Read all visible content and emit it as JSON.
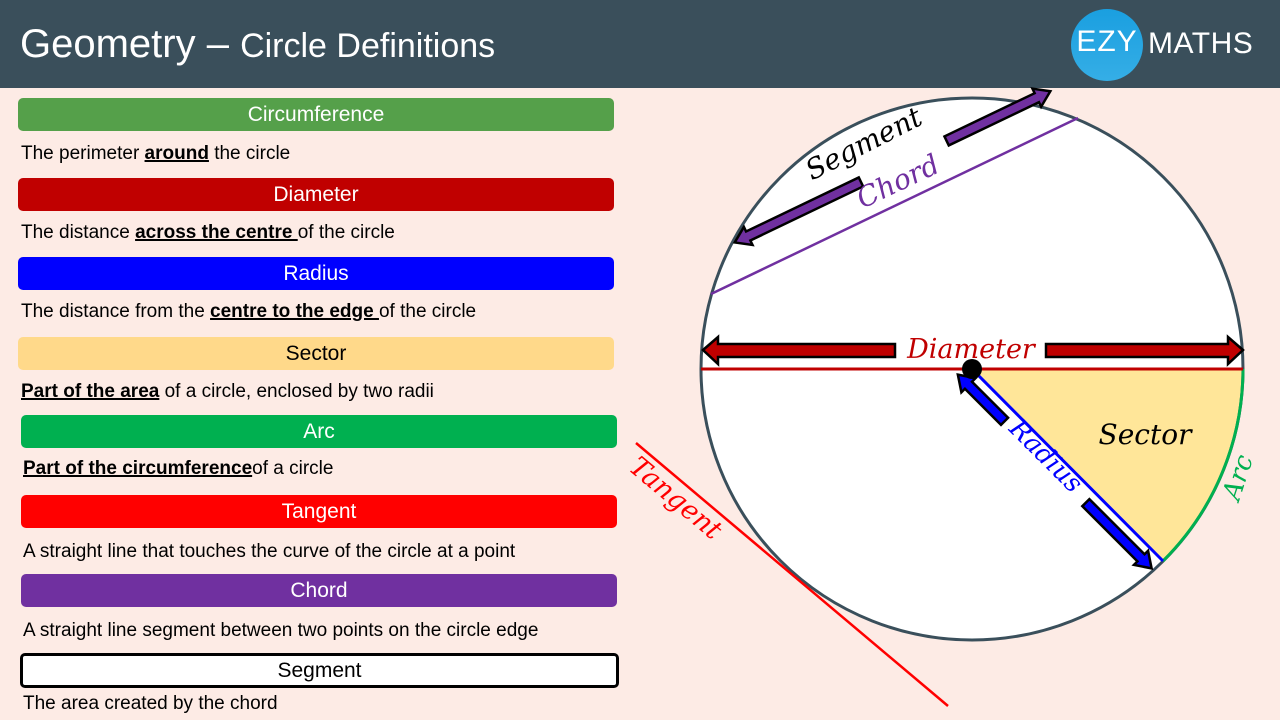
{
  "header": {
    "title_main": "Geometry – ",
    "title_sub": "Circle Definitions",
    "logo": {
      "badge": "EZY",
      "word": "MATHS",
      "badge_color": "#1ea3e2"
    }
  },
  "definitions": [
    {
      "term": "Circumference",
      "color": "#55a04a",
      "text_color": "#ffffff",
      "pre": "The perimeter ",
      "bold": "around",
      "post": " the circle"
    },
    {
      "term": "Diameter",
      "color": "#c00000",
      "text_color": "#ffffff",
      "pre": "The distance ",
      "bold": "across the centre ",
      "post": "of the circle"
    },
    {
      "term": "Radius",
      "color": "#0000ff",
      "text_color": "#ffffff",
      "pre": "The distance from the ",
      "bold": "centre to the edge ",
      "post": "of the circle"
    },
    {
      "term": "Sector",
      "color": "#ffd98a",
      "text_color": "#000000",
      "pre": "",
      "bold": "Part of the area",
      "post": " of a circle, enclosed by two radii"
    },
    {
      "term": "Arc",
      "color": "#00b050",
      "text_color": "#ffffff",
      "pre": "",
      "bold": "Part of the circumference",
      "post": "of a circle"
    },
    {
      "term": "Tangent",
      "color": "#ff0000",
      "text_color": "#ffffff",
      "pre": "A straight line that touches the curve of the circle at a point",
      "bold": "",
      "post": ""
    },
    {
      "term": "Chord",
      "color": "#7030a0",
      "text_color": "#ffffff",
      "pre": "A straight line segment between two points on the circle edge",
      "bold": "",
      "post": ""
    },
    {
      "term": "Segment",
      "color": "#ffffff",
      "text_color": "#000000",
      "pre": "The area created by the chord",
      "bold": "",
      "post": ""
    }
  ],
  "diagram": {
    "labels": {
      "segment": "Segment",
      "chord": "Chord",
      "diameter": "Diameter",
      "radius": "Radius",
      "sector": "Sector",
      "arc": "Arc",
      "tangent": "Tangent"
    },
    "colors": {
      "circle": "#3a4f5b",
      "chord": "#7030a0",
      "diameter": "#c00000",
      "radius": "#0000ff",
      "sector": "#ffe699",
      "arc": "#00b050",
      "tangent": "#ff0000"
    }
  }
}
